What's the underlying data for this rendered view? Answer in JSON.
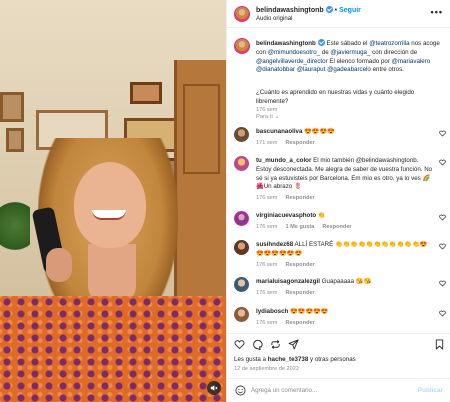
{
  "header": {
    "username": "belindawashingtonb",
    "follow_label": "Seguir",
    "audio_label": "Audio original",
    "separator": "•",
    "more_label": "•••"
  },
  "caption": {
    "username": "belindawashingtonb",
    "text_1": "Este sábado el ",
    "mention_1": "@teatrozorrilla",
    "text_2": " nos acoge con ",
    "mention_2": "@mimundoesotro_",
    "text_3": " de ",
    "mention_3": "@javiermuga_",
    "text_4": " con dirección de ",
    "mention_4": "@angelvillaverde_director",
    "text_5": " El elenco formado por ",
    "mention_5": "@mariavalero",
    "text_6": " ",
    "mention_6": "@dianatobbar",
    "text_7": " ",
    "mention_7": "@lauraput",
    "text_8": " ",
    "mention_8": "@gadeabarcelo",
    "text_9": " entre otros.",
    "question": "¿Cuánto es aprendido en nuestras vidas y cuánto elegido libremente?",
    "time": "176 sem"
  },
  "para_ti": "Para ti",
  "comments": [
    {
      "username": "bascunanaoliva",
      "text": "😍😍😍😍",
      "time": "171 sem",
      "reply": "Responder",
      "likes": ""
    },
    {
      "username": "tu_mundo_a_color",
      "text": "El mio también @belindawashingtonb. Estoy desconectada. Me alegra de saber de vuestra función. No sé si ya estuvisteis por Barcelona. Em mio es otro, ya lo ves 🌈🌺Un abrazo 🌷",
      "time": "176 sem",
      "reply": "Responder",
      "likes": ""
    },
    {
      "username": "virginiacuevasphoto",
      "text": "👏",
      "time": "176 sem",
      "reply": "Responder",
      "likes": "1 Me gusta"
    },
    {
      "username": "susihndez68",
      "text": "ALLÍ ESTARÉ 👏👏👏👏👏👏👏👏👏👏👏😍😍😍😍😍😍😍",
      "time": "176 sem",
      "reply": "Responder",
      "likes": ""
    },
    {
      "username": "marialuisagonzalezgil",
      "text": "Guapaaaaa 😘😘",
      "time": "176 sem",
      "reply": "Responder",
      "likes": ""
    },
    {
      "username": "lydiabosch",
      "text": "😍😍😍😍😍",
      "time": "176 sem",
      "reply": "Responder",
      "likes": ""
    }
  ],
  "likes": {
    "prefix": "Les gusta a ",
    "user": "hache_te3738",
    "suffix": " y otras personas"
  },
  "date": "12 de septiembre de 2022",
  "add_comment": {
    "placeholder": "Agrega un comentario...",
    "publish_label": "Publicar"
  },
  "colors": {
    "accent": "#0095f6",
    "mention": "#00376b",
    "muted": "#8e8e8e",
    "verified": "#3897f0"
  }
}
